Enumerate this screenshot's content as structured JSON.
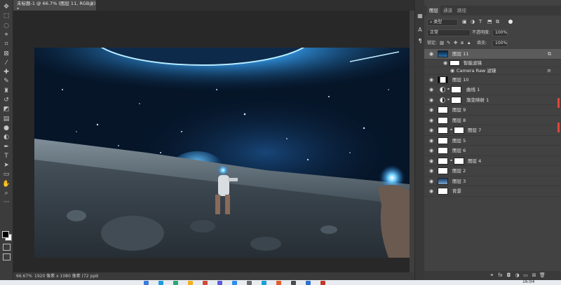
{
  "document": {
    "tab_title": "未标题-1 @ 66.7% (图层 11, RGB/8) *",
    "close_glyph": "×"
  },
  "status": {
    "zoom": "66.67%",
    "doc_info": "1920 像素 x 1080 像素 (72 ppi)",
    "arrow": "›"
  },
  "toolbar": {
    "tools": [
      {
        "name": "move-tool-icon",
        "glyph": "✥"
      },
      {
        "name": "marquee-tool-icon",
        "glyph": "⬚"
      },
      {
        "name": "lasso-tool-icon",
        "glyph": "◌"
      },
      {
        "name": "quick-select-tool-icon",
        "glyph": "⌖"
      },
      {
        "name": "crop-tool-icon",
        "glyph": "⌗"
      },
      {
        "name": "frame-tool-icon",
        "glyph": "⊠"
      },
      {
        "name": "eyedropper-tool-icon",
        "glyph": "⁄"
      },
      {
        "name": "healing-brush-tool-icon",
        "glyph": "✚"
      },
      {
        "name": "brush-tool-icon",
        "glyph": "✎"
      },
      {
        "name": "clone-stamp-tool-icon",
        "glyph": "♜"
      },
      {
        "name": "history-brush-tool-icon",
        "glyph": "↺"
      },
      {
        "name": "eraser-tool-icon",
        "glyph": "◩"
      },
      {
        "name": "gradient-tool-icon",
        "glyph": "▤"
      },
      {
        "name": "blur-tool-icon",
        "glyph": "●"
      },
      {
        "name": "dodge-tool-icon",
        "glyph": "◐"
      },
      {
        "name": "pen-tool-icon",
        "glyph": "✒"
      },
      {
        "name": "type-tool-icon",
        "glyph": "T"
      },
      {
        "name": "path-select-tool-icon",
        "glyph": "➤"
      },
      {
        "name": "rectangle-tool-icon",
        "glyph": "▭"
      },
      {
        "name": "hand-tool-icon",
        "glyph": "✋"
      },
      {
        "name": "zoom-tool-icon",
        "glyph": "⌕"
      },
      {
        "name": "more-tools-icon",
        "glyph": "···"
      }
    ]
  },
  "dock": {
    "icons": [
      {
        "name": "history-panel-icon",
        "glyph": "▦"
      },
      {
        "name": "character-panel-icon",
        "glyph": "A"
      },
      {
        "name": "paragraph-panel-icon",
        "glyph": "¶"
      }
    ]
  },
  "panel": {
    "tabs": [
      {
        "label": "图层",
        "active": true
      },
      {
        "label": "通道",
        "active": false
      },
      {
        "label": "路径",
        "active": false
      }
    ],
    "filter_kind": "类型",
    "blend_mode": "正常",
    "opacity_label": "不透明度:",
    "opacity_value": "100%",
    "lock_label": "锁定:",
    "fill_label": "填充:",
    "fill_value": "100%",
    "smart_filters_label": "智能滤镜",
    "camera_raw_label": "Camera Raw 滤镜"
  },
  "layers": [
    {
      "name": "图层 11",
      "kind": "image",
      "selected": true
    },
    {
      "name": "图层 10",
      "kind": "image",
      "selected": false
    },
    {
      "name": "曲线 1",
      "kind": "adjustment",
      "selected": false
    },
    {
      "name": "渐变映射 1",
      "kind": "adjustment",
      "selected": false
    },
    {
      "name": "图层 9",
      "kind": "image",
      "selected": false
    },
    {
      "name": "图层 8",
      "kind": "image",
      "selected": false
    },
    {
      "name": "图层 7",
      "kind": "masked",
      "selected": false
    },
    {
      "name": "图层 5",
      "kind": "image",
      "selected": false
    },
    {
      "name": "图层 6",
      "kind": "image",
      "selected": false
    },
    {
      "name": "图层 4",
      "kind": "masked",
      "selected": false
    },
    {
      "name": "图层 2",
      "kind": "image",
      "selected": false
    },
    {
      "name": "图层 3",
      "kind": "image",
      "selected": false
    },
    {
      "name": "背景",
      "kind": "image",
      "selected": false
    }
  ],
  "taskbar": {
    "time": "16:04"
  },
  "colors": {
    "accent_red": "#e0463e",
    "selected_layer": "#5b5b5b",
    "panel_bg": "#424242",
    "canvas_bg": "#282828"
  }
}
